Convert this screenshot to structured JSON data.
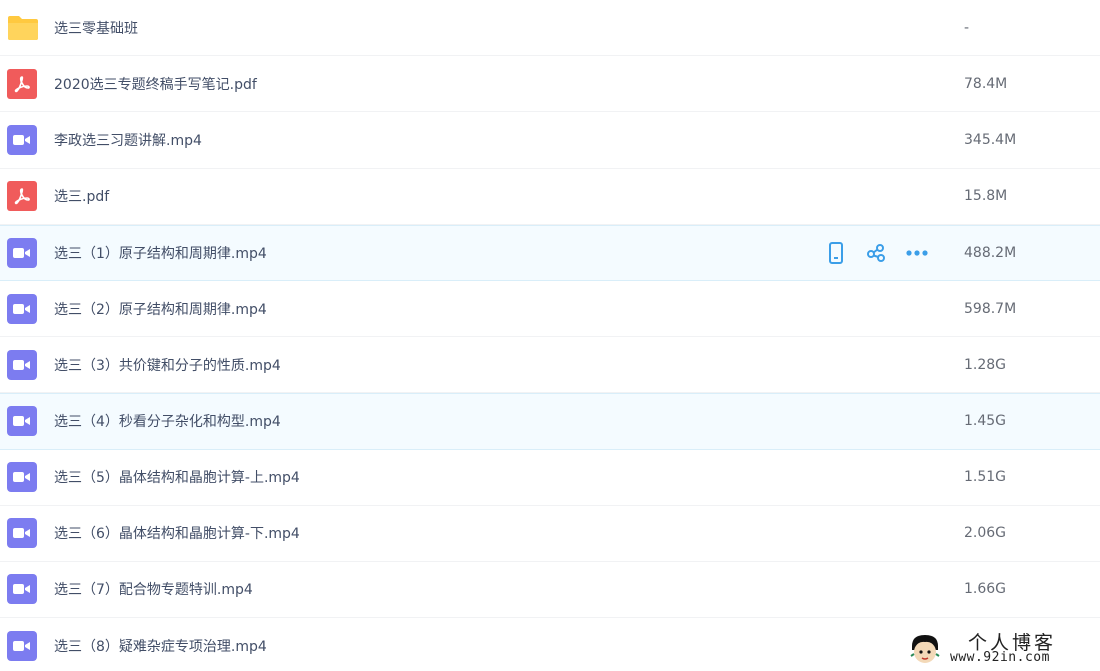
{
  "files": [
    {
      "type": "folder",
      "icon": "folder-icon",
      "name": "选三零基础班",
      "size": "-"
    },
    {
      "type": "pdf",
      "icon": "pdf-icon",
      "name": "2020选三专题终稿手写笔记.pdf",
      "size": "78.4M"
    },
    {
      "type": "video",
      "icon": "video-icon",
      "name": "李政选三习题讲解.mp4",
      "size": "345.4M"
    },
    {
      "type": "pdf",
      "icon": "pdf-icon",
      "name": "选三.pdf",
      "size": "15.8M"
    },
    {
      "type": "video",
      "icon": "video-icon",
      "name": "选三（1）原子结构和周期律.mp4",
      "size": "488.2M"
    },
    {
      "type": "video",
      "icon": "video-icon",
      "name": "选三（2）原子结构和周期律.mp4",
      "size": "598.7M"
    },
    {
      "type": "video",
      "icon": "video-icon",
      "name": "选三（3）共价键和分子的性质.mp4",
      "size": "1.28G"
    },
    {
      "type": "video",
      "icon": "video-icon",
      "name": "选三（4）秒看分子杂化和构型.mp4",
      "size": "1.45G"
    },
    {
      "type": "video",
      "icon": "video-icon",
      "name": "选三（5）晶体结构和晶胞计算-上.mp4",
      "size": "1.51G"
    },
    {
      "type": "video",
      "icon": "video-icon",
      "name": "选三（6）晶体结构和晶胞计算-下.mp4",
      "size": "2.06G"
    },
    {
      "type": "video",
      "icon": "video-icon",
      "name": "选三（7）配合物专题特训.mp4",
      "size": "1.66G"
    },
    {
      "type": "video",
      "icon": "video-icon",
      "name": "选三（8）疑难杂症专项治理.mp4",
      "size": ""
    }
  ],
  "hover_actions": {
    "icons": [
      "phone-icon",
      "share-icon",
      "more-icon"
    ]
  },
  "watermark": {
    "title": "个人博客",
    "url": "www.92in.com"
  },
  "colors": {
    "video": "#7c7cf0",
    "pdf": "#f05b5b",
    "folder": "#ffc940",
    "action": "#3b9ee8",
    "hover_bg": "#f4fbff"
  }
}
